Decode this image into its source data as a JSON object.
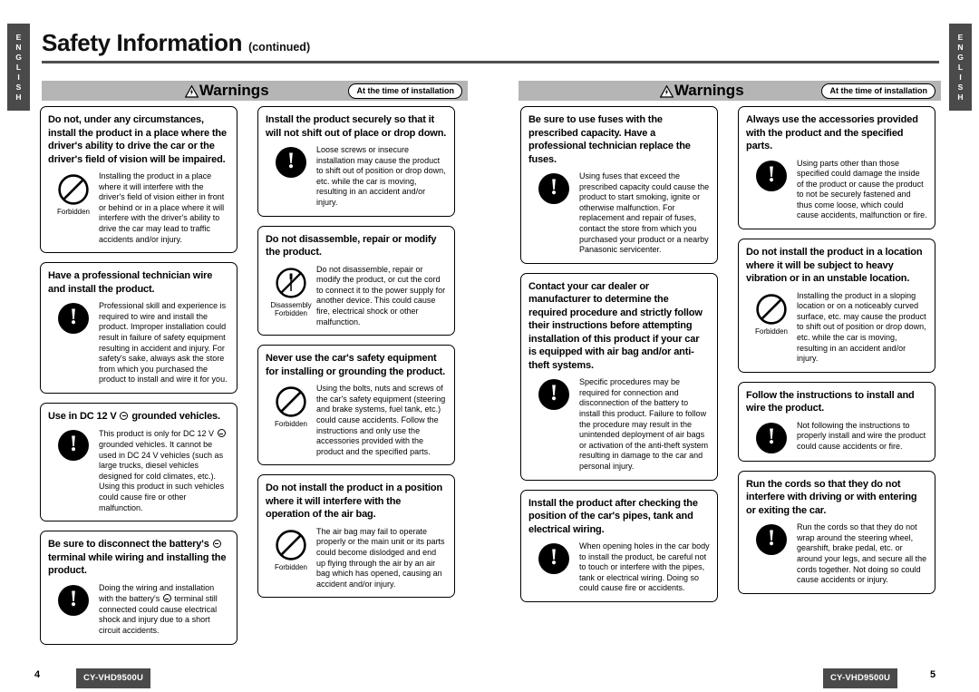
{
  "document": {
    "title": "Safety Information",
    "title_suffix": "(continued)",
    "language_tab": [
      "E",
      "N",
      "G",
      "L",
      "I",
      "S",
      "H"
    ],
    "model": "CY-VHD9500U",
    "page_left": "4",
    "page_right": "5",
    "accent_bar_color": "#4f4f4f",
    "warn_bar_color": "#b5b5b5",
    "chip_color": "#4a4a4a"
  },
  "warning_headers": {
    "left": {
      "label": "Warnings",
      "badge": "At the time of installation",
      "icon": "warning-triangle-icon"
    },
    "right": {
      "label": "Warnings",
      "badge": "At the time of installation",
      "icon": "warning-triangle-icon"
    }
  },
  "columns": [
    {
      "id": "col-1",
      "boxes": [
        {
          "heading": "Do not, under any circumstances, install the product in a place where the driver's ability to drive the car or the driver's field of vision will be impaired.",
          "icon": "forbidden-icon",
          "icon_label": "Forbidden",
          "body": "Installing the product in a place where it will interfere with the driver's field of vision either in front or behind or in a place where it will interfere with the driver's ability to drive the car may lead to traffic accidents and/or injury."
        },
        {
          "heading": "Have a professional technician wire and install the product.",
          "icon": "exclamation-icon",
          "icon_label": "",
          "body": "Professional skill and experience is required to wire and install the product. Improper installation could result in failure of safety equipment resulting in accident and injury. For safety's sake, always ask the store from which you purchased the product to install and wire it for you."
        },
        {
          "heading_parts": [
            "Use in DC 12 V ",
            " grounded vehicles."
          ],
          "heading_symbol": "negative-terminal-symbol",
          "icon": "exclamation-icon",
          "icon_label": "",
          "body_parts": [
            "This product is only for DC 12 V ",
            " grounded vehicles. It cannot be used in DC 24 V vehicles (such as large trucks, diesel vehicles designed for cold climates, etc.). Using this product in such vehicles could cause fire or other malfunction."
          ],
          "body_symbol": "negative-terminal-symbol"
        },
        {
          "heading_parts": [
            "Be sure to disconnect the battery's ",
            " terminal while wiring and installing the product."
          ],
          "heading_symbol": "negative-terminal-symbol",
          "icon": "exclamation-icon",
          "icon_label": "",
          "body_parts": [
            "Doing the wiring and installation with the battery's ",
            " terminal still connected could cause electrical shock and injury due to a short circuit accidents."
          ],
          "body_symbol": "negative-terminal-symbol"
        }
      ]
    },
    {
      "id": "col-2",
      "boxes": [
        {
          "heading": "Install the product securely so that it will not shift out of place or drop down.",
          "icon": "exclamation-icon",
          "icon_label": "",
          "body": "Loose screws or insecure installation may cause the product to shift out of position or drop down, etc. while the car is moving, resulting in an accident and/or injury."
        },
        {
          "heading": "Do not disassemble, repair or modify the product.",
          "icon": "disassembly-forbidden-icon",
          "icon_label": "Disassembly Forbidden",
          "body": "Do not disassemble, repair or modify the product, or cut the cord to connect it to the power supply for another device.  This could cause fire, electrical shock or other malfunction."
        },
        {
          "heading": "Never use the car's safety equipment for installing or grounding the product.",
          "icon": "forbidden-icon",
          "icon_label": "Forbidden",
          "body": "Using the bolts, nuts and screws of the car's safety equipment (steering and brake systems, fuel tank, etc.) could cause accidents. Follow the instructions and only use the accessories provided with the product and the specified parts."
        },
        {
          "heading": "Do not install the product in a position where it will interfere with the operation of the air bag.",
          "icon": "forbidden-icon",
          "icon_label": "Forbidden",
          "body": "The air bag may fail to operate properly or the main unit or its parts could become dislodged and end up flying through the air by an air bag which has opened, causing an accident and/or injury."
        }
      ]
    },
    {
      "id": "col-3",
      "boxes": [
        {
          "heading": "Be sure to use fuses with the prescribed capacity. Have a professional technician replace the fuses.",
          "icon": "exclamation-icon",
          "icon_label": "",
          "body": "Using fuses that exceed the prescribed capacity could cause the product to start smoking, ignite or otherwise malfunction. For replacement and repair of fuses, contact the store from which you purchased your product or a nearby Panasonic servicenter."
        },
        {
          "heading": "Contact your car dealer or manufacturer to determine the required procedure and strictly follow their instructions before attempting installation of this product if your car is equipped with air bag and/or anti-theft systems.",
          "icon": "exclamation-icon",
          "icon_label": "",
          "body": "Specific procedures may be required for connection and disconnection of the battery to install this product. Failure to follow the procedure may result in the unintended deployment of air bags or activation of the anti-theft system resulting in damage to the car and personal injury."
        },
        {
          "heading": "Install the product after checking the position of the car's pipes, tank and electrical wiring.",
          "icon": "exclamation-icon",
          "icon_label": "",
          "body": "When opening holes in the car body to install the product, be careful not to touch or interfere with the pipes, tank or electrical wiring. Doing so could cause fire or accidents."
        }
      ]
    },
    {
      "id": "col-4",
      "boxes": [
        {
          "heading": "Always use the accessories provided with the product and the specified parts.",
          "icon": "exclamation-icon",
          "icon_label": "",
          "body": "Using parts other than those specified could damage the inside of the product or cause the product to not be securely fastened and thus come loose, which could cause accidents, malfunction or fire."
        },
        {
          "heading": "Do not install the product in a location where it will be subject to heavy vibration or in an unstable location.",
          "icon": "forbidden-icon",
          "icon_label": "Forbidden",
          "body": "Installing the product in a sloping location or on a noticeably curved surface, etc. may cause the product to shift out of position or drop down, etc. while the car is moving, resulting in an accident and/or injury."
        },
        {
          "heading": "Follow the instructions to install and wire the product.",
          "icon": "exclamation-icon",
          "icon_label": "",
          "body": "Not following the instructions to properly install and wire the product could cause accidents or fire."
        },
        {
          "heading": "Run the cords so that they do not interfere with driving or with entering or exiting the car.",
          "icon": "exclamation-icon",
          "icon_label": "",
          "body": "Run the cords so that they do not wrap around the steering wheel, gearshift, brake pedal, etc. or around your legs, and secure all the cords together. Not doing so could cause accidents or injury."
        }
      ]
    }
  ]
}
